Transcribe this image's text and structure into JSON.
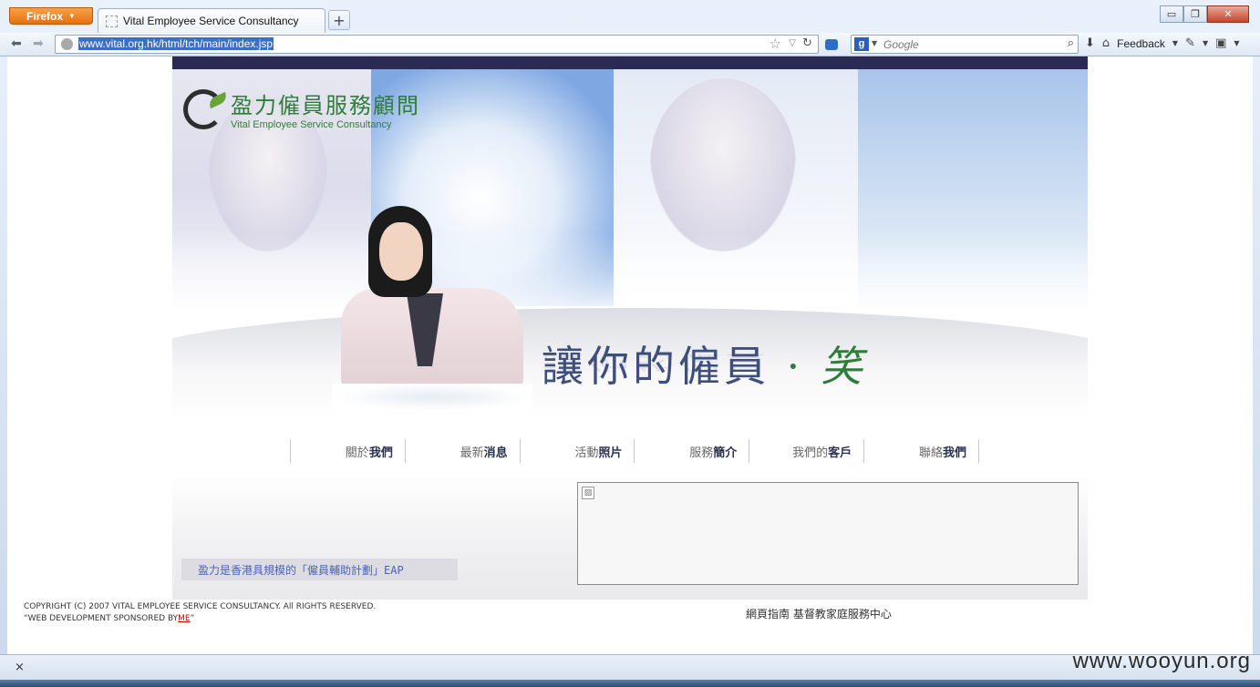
{
  "browser": {
    "firefox_button": "Firefox",
    "tab_title": "Vital Employee Service Consultancy",
    "new_tab": "+",
    "url": "www.vital.org.hk/html/tch/main/index.jsp",
    "search_placeholder": "Google",
    "feedback_label": "Feedback",
    "window_controls": {
      "minimize": "▭",
      "restore": "❐",
      "close": "✕"
    }
  },
  "site": {
    "logo_cn": "盈力僱員服務顧問",
    "logo_en": "Vital Employee Service Consultancy",
    "slogan_main": "讓你的僱員",
    "slogan_dot": "·",
    "slogan_smile": "笑",
    "menu": [
      {
        "plain": "關於",
        "bold": "我們"
      },
      {
        "plain": "最新",
        "bold": "消息"
      },
      {
        "plain": "活動",
        "bold": "照片"
      },
      {
        "plain": "服務",
        "bold": "簡介"
      },
      {
        "plain": "我們的",
        "bold": "客戶"
      },
      {
        "plain": "聯絡",
        "bold": "我們"
      }
    ],
    "eap_text": "盈力是香港具規模的「僱員輔助計劃」EAP",
    "copyright_line1": "COPYRIGHT (C) 2007 VITAL EMPLOYEE SERVICE CONSULTANCY. All RIGHTS RESERVED.",
    "copyright_line2_prefix": "“WEB DEVELOPMENT SPONSORED BY",
    "copyright_line2_link": "ME",
    "copyright_line2_suffix": "”",
    "footer_links": "網頁指南  基督教家庭服務中心"
  },
  "statusbar": {
    "close_find": "×",
    "watermark": "www.wooyun.org"
  },
  "colors": {
    "accent_green": "#2f7d3a",
    "slogan_blue": "#3f4f7b",
    "top_strip": "#2b2a55"
  }
}
